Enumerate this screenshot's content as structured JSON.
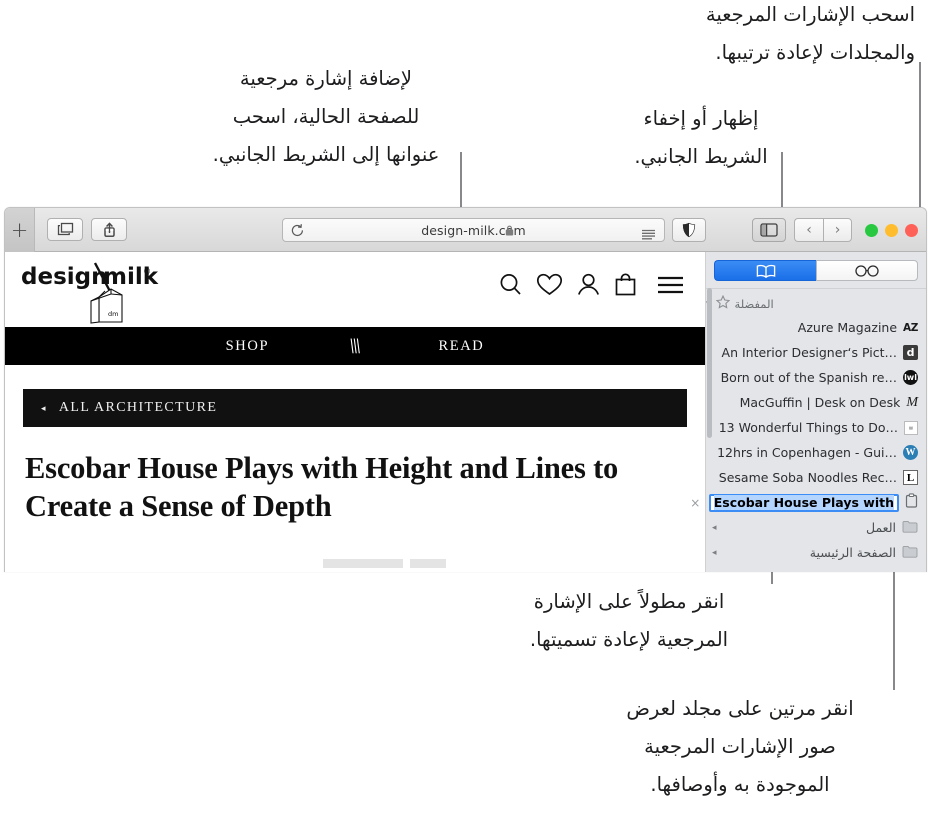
{
  "callouts": {
    "drag_reorder": "اسحب الإشارات المرجعية\nوالمجلدات لإعادة ترتيبها.",
    "add_bookmark": "لإضافة إشارة مرجعية\nللصفحة الحالية، اسحب\nعنوانها إلى الشريط الجانبي.",
    "show_hide_sidebar": "إظهار أو إخفاء\nالشريط الجانبي.",
    "long_click_rename": "انقر مطولاً على الإشارة\nالمرجعية لإعادة تسميتها.",
    "double_click_folder": "انقر مرتين على مجلد لعرض\nصور الإشارات المرجعية\nالموجودة به وأوصافها."
  },
  "toolbar": {
    "new_tab_label": "+",
    "tabs_overview_icon": "tab-overview-icon",
    "share_icon": "share-icon",
    "reload_icon": "reload-icon",
    "address_text": "design-milk.com",
    "lock_icon": "lock-icon",
    "reader_icon": "reader-view-icon",
    "privacy_icon": "privacy-report-icon",
    "sidebar_toggle_icon": "sidebar-toggle-icon",
    "back_label": "‹",
    "forward_label": "›",
    "window_close_color": "#ff6159",
    "window_minimize_color": "#ffbd2e",
    "window_zoom_color": "#28c941"
  },
  "page": {
    "logo_text_left": "design",
    "logo_slash": "\\",
    "logo_text_right": "milk",
    "logo_registered": "®",
    "logo_carton_label": "dm",
    "header_icons": [
      {
        "name": "search-icon"
      },
      {
        "name": "heart-icon"
      },
      {
        "name": "account-icon"
      },
      {
        "name": "shopping-bag-icon"
      },
      {
        "name": "hamburger-menu-icon"
      }
    ],
    "nav": [
      {
        "label": "SHOP"
      },
      {
        "label": "\\\\\\"
      },
      {
        "label": "READ"
      }
    ],
    "breadcrumb_arrow": "◂",
    "breadcrumb": "ALL ARCHITECTURE",
    "headline": "Escobar House Plays with Height and Lines to Create a Sense of Depth"
  },
  "sidebar": {
    "segments": [
      {
        "name": "reading-list-tab",
        "icon": "glasses-icon",
        "active": false
      },
      {
        "name": "bookmarks-tab",
        "icon": "book-icon",
        "active": true
      }
    ],
    "favorites_group": {
      "label": "المفضلة",
      "star_icon": "star-icon",
      "disclosure": "▾"
    },
    "bookmarks": [
      {
        "title": "Azure Magazine",
        "favicon": "az"
      },
      {
        "title": "An Interior Designer‘s Pict…",
        "favicon": "d"
      },
      {
        "title": "Born out of the Spanish re…",
        "favicon": "lwl"
      },
      {
        "title": "MacGuffin | Desk on Desk",
        "favicon": "m"
      },
      {
        "title": "13 Wonderful Things to Do…",
        "favicon": "thirteen"
      },
      {
        "title": "12hrs in Copenhagen - Gui…",
        "favicon": "wordpress"
      },
      {
        "title": "Sesame Soba Noodles Rec…",
        "favicon": "l"
      }
    ],
    "editing_bookmark": {
      "value": "Escobar House Plays with",
      "favicon": "reader",
      "delete_icon": "×"
    },
    "folders": [
      {
        "label": "العمل",
        "icon": "folder-icon",
        "disclosure": "◂"
      },
      {
        "label": "الصفحة الرئيسية",
        "icon": "folder-icon",
        "disclosure": "◂"
      }
    ]
  },
  "colors": {
    "accent_blue": "#1a6fe8",
    "selection_blue": "#b4d5fe",
    "sidebar_bg": "#e3e5e8",
    "nav_black": "#000000"
  }
}
